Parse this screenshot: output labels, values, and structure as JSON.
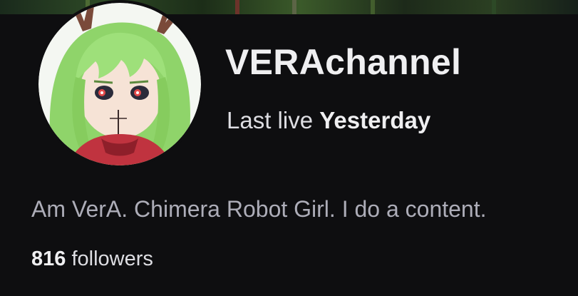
{
  "profile": {
    "channel_name": "VERAchannel",
    "last_live_label": "Last live",
    "last_live_value": "Yesterday",
    "bio": "Am VerA. Chimera Robot Girl. I do a content.",
    "followers_count": "816",
    "followers_label": "followers",
    "avatar_icon": "avatar-image"
  },
  "colors": {
    "background": "#0e0e10",
    "primary_text": "#efeff1",
    "secondary_text": "#adadb8"
  }
}
